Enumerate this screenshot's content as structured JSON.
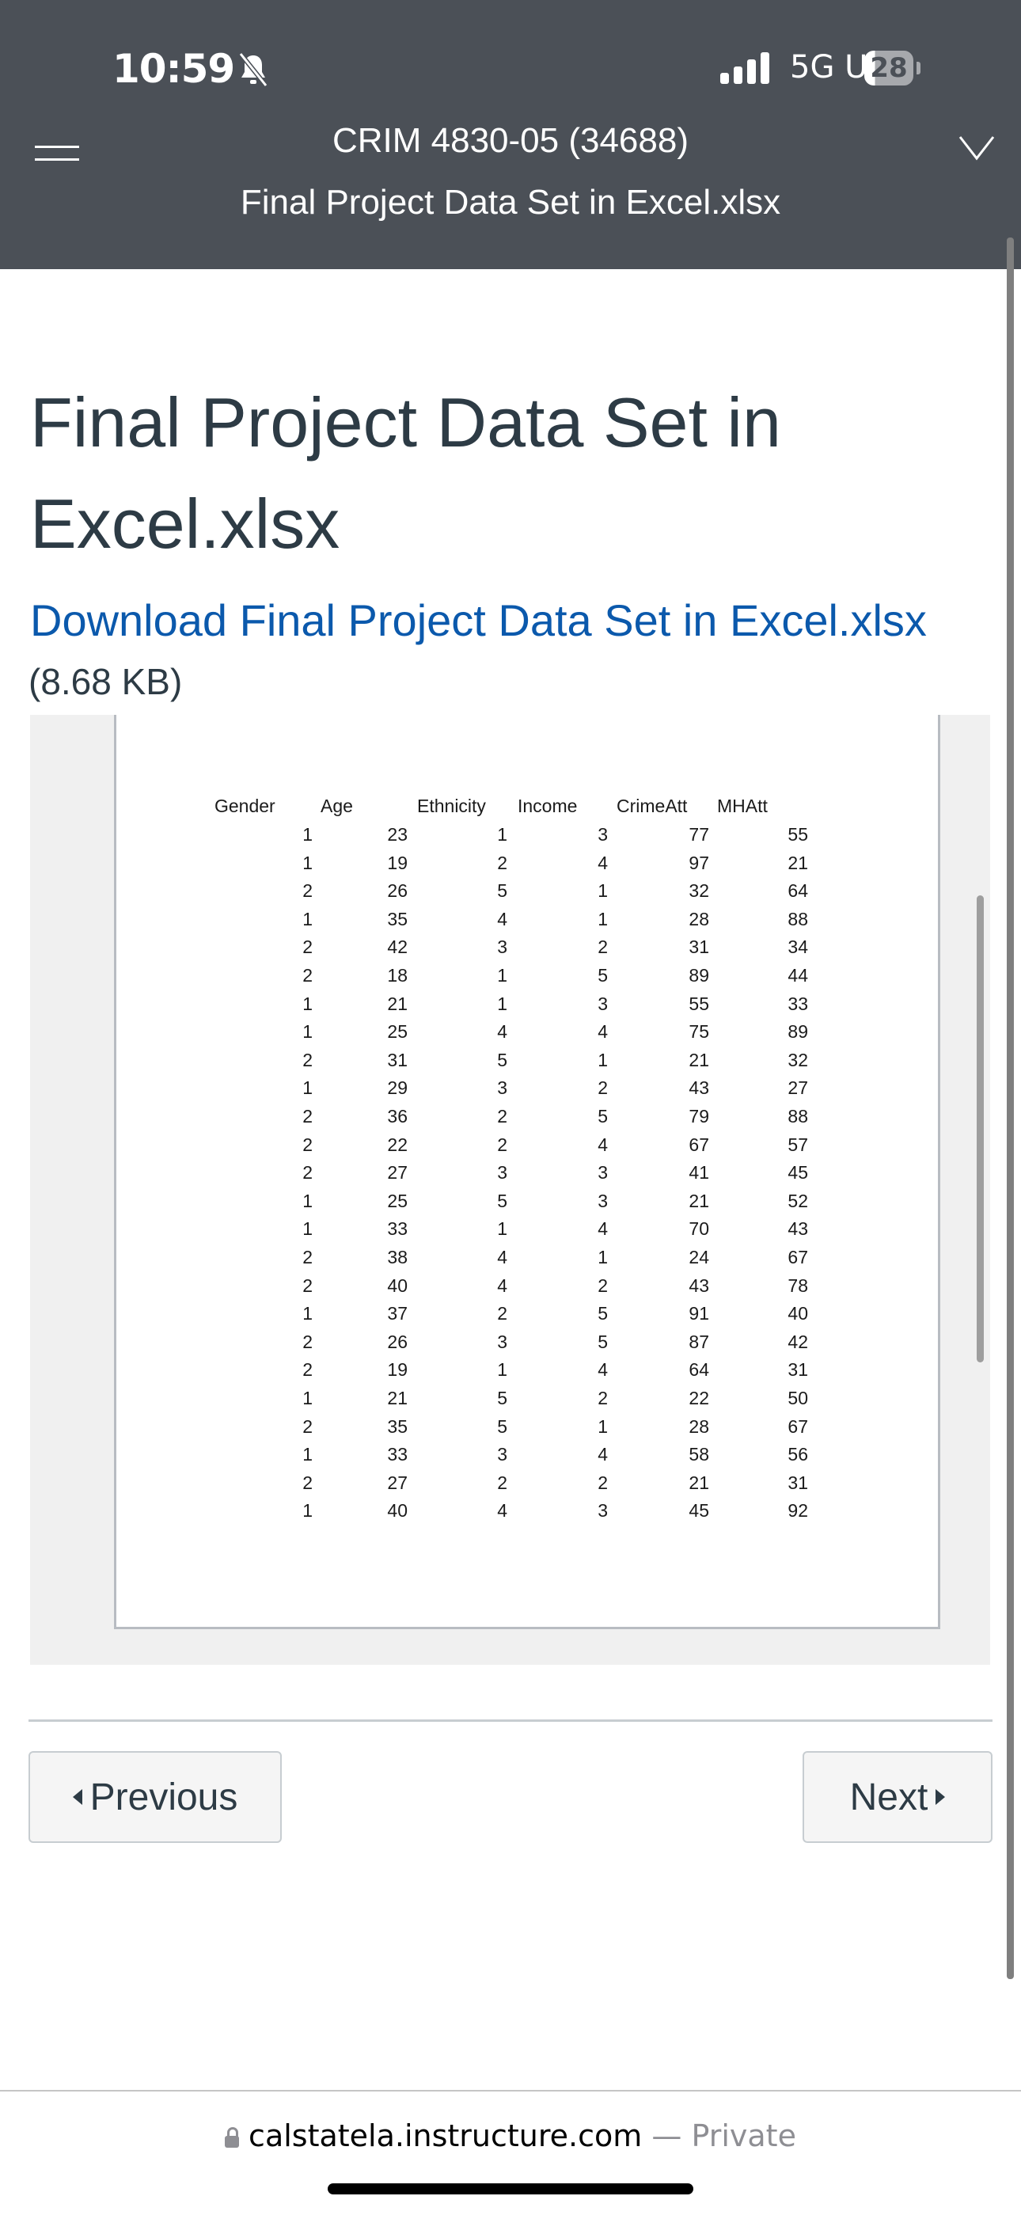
{
  "status_bar": {
    "time": "10:59",
    "network": "5G UC",
    "battery": "28",
    "icons": [
      "bell-slash-icon",
      "signal-icon",
      "battery-icon"
    ]
  },
  "header": {
    "course": "CRIM 4830-05 (34688)",
    "subtitle": "Final Project Data Set in Excel.xlsx",
    "icons": [
      "menu-icon",
      "chevron-down-icon"
    ]
  },
  "page": {
    "title": "Final Project Data Set in Excel.xlsx",
    "download_link": "Download Final Project Data Set in Excel.xlsx",
    "file_size": "(8.68 KB)"
  },
  "spreadsheet": {
    "columns": [
      "Gender",
      "Age",
      "Ethnicity",
      "Income",
      "CrimeAtt",
      "MHAtt"
    ],
    "rows": [
      [
        1,
        23,
        1,
        3,
        77,
        55
      ],
      [
        1,
        19,
        2,
        4,
        97,
        21
      ],
      [
        2,
        26,
        5,
        1,
        32,
        64
      ],
      [
        1,
        35,
        4,
        1,
        28,
        88
      ],
      [
        2,
        42,
        3,
        2,
        31,
        34
      ],
      [
        2,
        18,
        1,
        5,
        89,
        44
      ],
      [
        1,
        21,
        1,
        3,
        55,
        33
      ],
      [
        1,
        25,
        4,
        4,
        75,
        89
      ],
      [
        2,
        31,
        5,
        1,
        21,
        32
      ],
      [
        1,
        29,
        3,
        2,
        43,
        27
      ],
      [
        2,
        36,
        2,
        5,
        79,
        88
      ],
      [
        2,
        22,
        2,
        4,
        67,
        57
      ],
      [
        2,
        27,
        3,
        3,
        41,
        45
      ],
      [
        1,
        25,
        5,
        3,
        21,
        52
      ],
      [
        1,
        33,
        1,
        4,
        70,
        43
      ],
      [
        2,
        38,
        4,
        1,
        24,
        67
      ],
      [
        2,
        40,
        4,
        2,
        43,
        78
      ],
      [
        1,
        37,
        2,
        5,
        91,
        40
      ],
      [
        2,
        26,
        3,
        5,
        87,
        42
      ],
      [
        2,
        19,
        1,
        4,
        64,
        31
      ],
      [
        1,
        21,
        5,
        2,
        22,
        50
      ],
      [
        2,
        35,
        5,
        1,
        28,
        67
      ],
      [
        1,
        33,
        3,
        4,
        58,
        56
      ],
      [
        2,
        27,
        2,
        2,
        21,
        31
      ],
      [
        1,
        40,
        4,
        3,
        45,
        92
      ]
    ]
  },
  "navigation": {
    "previous": "Previous",
    "next": "Next"
  },
  "browser": {
    "domain": "calstatela.instructure.com",
    "mode": "— Private"
  }
}
